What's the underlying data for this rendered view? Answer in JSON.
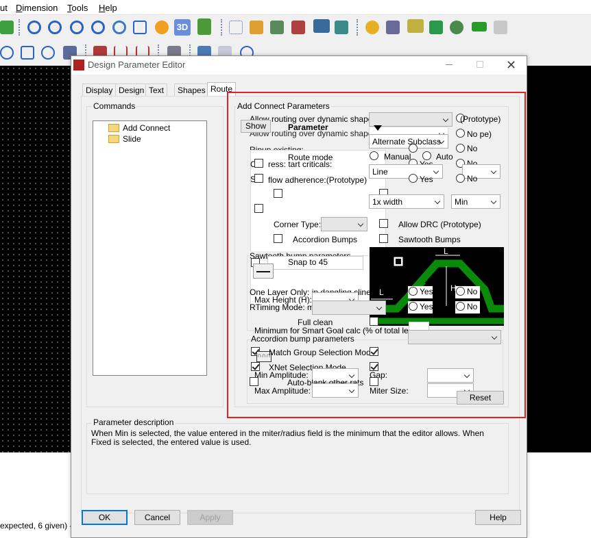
{
  "menu": {
    "items": [
      "ut",
      "Dimension",
      "Tools",
      "Help"
    ]
  },
  "dialog": {
    "title": "Design Parameter Editor",
    "tabs": [
      "Display",
      "Design",
      "Text",
      "Shapes",
      "Route"
    ],
    "commands_label": "Commands",
    "tree_items": [
      "Add Connect",
      "Slide"
    ],
    "group_title": "Add Connect Parameters",
    "show_label": "Show",
    "parameter_label": "Parameter",
    "texts": {
      "allow_dyn1": "Allow routing over dynamic shapes:(F",
      "allow_dyn2": "Allow routing over dynamic shapes:(Prototype)",
      "prototype": "(Prototype)",
      "no_pe": "No  pe)",
      "alternate_subclass": "Alternate Subclass",
      "ripup": "Ripup existing:",
      "route_mode": "Route mode",
      "manual": "Manual",
      "auto": "Auto",
      "yes": "Yes",
      "no": "No",
      "c_prefix": "C",
      "ress": "ress: tart criticals:",
      "s_prefix": "S",
      "flow_adherence": "flow adherence:(Prototype)",
      "line": "Line",
      "width": "1x width",
      "min": "Min",
      "corner_type": "Corner Type:",
      "allow_drc": "Allow DRC (Prototype)",
      "accordion_bumps": "Accordion Bumps",
      "sawtooth_bumps": "Sawtooth Bumps",
      "sawtooth_params": "Sawtooth bump parameters",
      "snap45": "Snap to 45",
      "one_layer": "One Layer Only: ip dangling clines",
      "max_height": "Max Height (H):",
      "rtiming": "RTiming Mode: mo",
      "full_clean": "Full clean",
      "min_smart": "Minimum for Smart Goal calc (% of total length):",
      "accordion_params": "Accordion bump parameters",
      "match_group": "Match Group Selection Mode",
      "xnet_mode": "XNet Selection Mode",
      "min_amplitude": "Min Amplitude:",
      "gap": "Gap:",
      "auto_blank": "Auto-blank other rats",
      "max_amplitude": "Max Amplitude:",
      "miter_size": "Miter Size:",
      "reset": "Reset",
      "L": "L",
      "H": "H"
    },
    "description_label": "Parameter description",
    "description": "When Min is selected, the value entered in the miter/radius field is the minimum that the editor allows.  When Fixed is selected, the entered value is used.",
    "buttons": {
      "ok": "OK",
      "cancel": "Cancel",
      "apply": "Apply",
      "help": "Help"
    }
  },
  "console": {
    "text": "expected, 6 given) - ("
  },
  "colors": {
    "highlight": "#e52020",
    "trace": "#0a8a0a",
    "canvas": "#000000"
  }
}
